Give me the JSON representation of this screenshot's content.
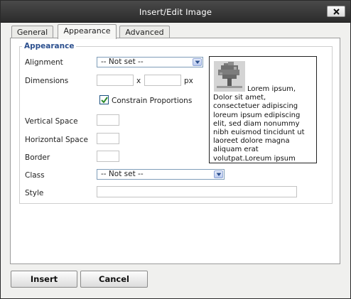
{
  "window": {
    "title": "Insert/Edit Image",
    "close_icon": "close-icon"
  },
  "tabs": [
    {
      "label": "General",
      "active": false
    },
    {
      "label": "Appearance",
      "active": true
    },
    {
      "label": "Advanced",
      "active": false
    }
  ],
  "appearance": {
    "legend": "Appearance",
    "alignment_label": "Alignment",
    "alignment_value": "-- Not set --",
    "dimensions_label": "Dimensions",
    "dimensions_sep": "x",
    "dimensions_unit": "px",
    "constrain_label": "Constrain Proportions",
    "constrain_checked": true,
    "vspace_label": "Vertical Space",
    "hspace_label": "Horizontal Space",
    "border_label": "Border",
    "class_label": "Class",
    "class_value": "-- Not set --",
    "style_label": "Style"
  },
  "preview": {
    "image_icon": "tree-image-icon",
    "text": "Lorem ipsum, Dolor sit amet, consectetuer adipiscing loreum ipsum edipiscing elit, sed diam nonummy nibh euismod tincidunt ut laoreet dolore magna aliquam erat volutpat.Loreum ipsum"
  },
  "buttons": {
    "insert": "Insert",
    "cancel": "Cancel"
  },
  "colors": {
    "titlebar": "#2c2c2c",
    "legend": "#2b4f8e",
    "check": "#2a8a2a"
  }
}
